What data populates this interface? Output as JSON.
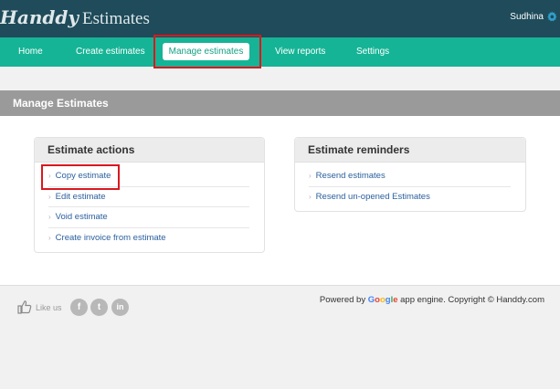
{
  "header": {
    "logo_brand": "Handdy",
    "logo_sub": "Estimates",
    "username": "Sudhina"
  },
  "nav": {
    "items": [
      "Home",
      "Create estimates",
      "Manage estimates",
      "View reports",
      "Settings"
    ],
    "active": "Manage estimates"
  },
  "page": {
    "title": "Manage Estimates"
  },
  "estimate_actions": {
    "title": "Estimate actions",
    "items": [
      "Copy estimate",
      "Edit estimate",
      "Void estimate",
      "Create invoice from estimate"
    ]
  },
  "estimate_reminders": {
    "title": "Estimate reminders",
    "items": [
      "Resend estimates",
      "Resend un-opened Estimates"
    ]
  },
  "footer": {
    "like_us": "Like us",
    "social": [
      "f",
      "t",
      "in"
    ],
    "powered_prefix": "Powered by",
    "google": [
      "G",
      "o",
      "o",
      "g",
      "l",
      "e"
    ],
    "powered_suffix": "app engine. Copyright © Handdy.com"
  },
  "colors": {
    "topbar": "#1f4b5a",
    "navbar": "#16b496",
    "highlight": "#d9181e",
    "link": "#2a5f9e"
  },
  "icons": [
    "gear-icon",
    "thumbs-up-icon",
    "facebook-icon",
    "twitter-icon",
    "linkedin-icon",
    "chevron-right-icon"
  ]
}
